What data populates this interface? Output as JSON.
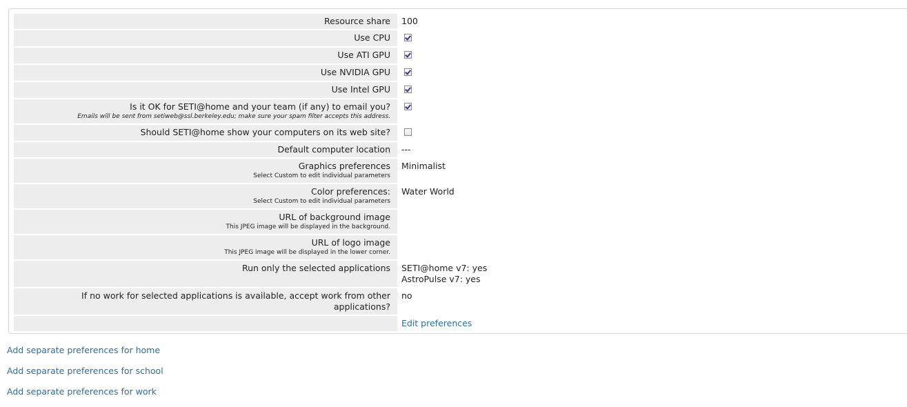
{
  "rows": [
    {
      "label": "Resource share",
      "value": "100"
    },
    {
      "label": "Use CPU",
      "checked": true
    },
    {
      "label": "Use ATI GPU",
      "checked": true
    },
    {
      "label": "Use NVIDIA GPU",
      "checked": true
    },
    {
      "label": "Use Intel GPU",
      "checked": true
    },
    {
      "label": "Is it OK for SETI@home and your team (if any) to email you?",
      "sub": "Emails will be sent from setiweb@ssl.berkeley.edu; make sure your spam filter accepts this address.",
      "checked": true
    },
    {
      "label": "Should SETI@home show your computers on its web site?",
      "checked": false
    },
    {
      "label": "Default computer location",
      "value": "---"
    },
    {
      "label": "Graphics preferences",
      "sub": "Select Custom to edit individual parameters",
      "value": "Minimalist"
    },
    {
      "label": "Color preferences:",
      "sub": "Select Custom to edit individual parameters",
      "value": "Water World"
    },
    {
      "label": "URL of background image",
      "sub": "This JPEG image will be displayed in the background.",
      "value": ""
    },
    {
      "label": "URL of logo image",
      "sub": "This JPEG image will be displayed in the lower corner.",
      "value": ""
    },
    {
      "label": "Run only the selected applications",
      "values": [
        "SETI@home v7: yes",
        "AstroPulse v7: yes"
      ]
    },
    {
      "label": "If no work for selected applications is available, accept work from other applications?",
      "value": "no"
    }
  ],
  "edit_link": "Edit preferences",
  "links": [
    "Add separate preferences for home",
    "Add separate preferences for school",
    "Add separate preferences for work"
  ]
}
